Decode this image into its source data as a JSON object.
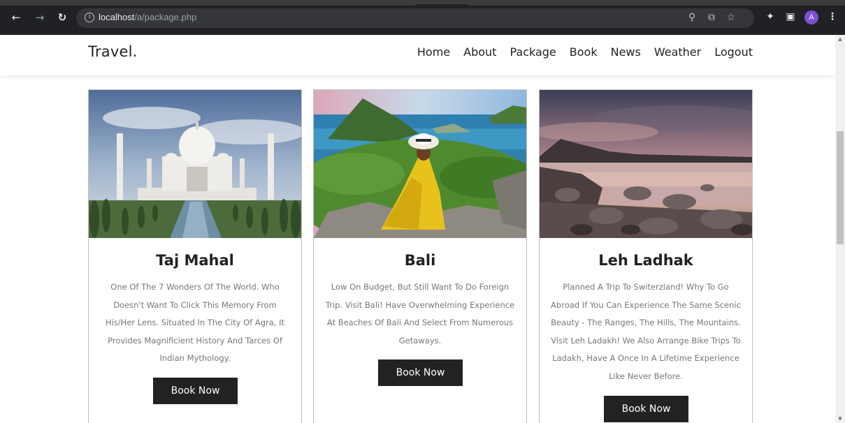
{
  "browser": {
    "back_icon": "arrow-left-icon",
    "forward_icon": "arrow-right-icon",
    "reload_icon": "reload-icon",
    "url_host": "localhost",
    "url_path": "/a/package.php",
    "profile_initial": "A"
  },
  "site": {
    "logo": "Travel.",
    "nav": [
      "Home",
      "About",
      "Package",
      "Book",
      "News",
      "Weather",
      "Logout"
    ]
  },
  "packages": [
    {
      "title": "Taj Mahal",
      "description": "One Of The 7 Wonders Of The World. Who Doesn't Want To Click This Memory From His/Her Lens. Situated In The City Of Agra, It Provides Magnificient History And Tarces Of Indian Mythology.",
      "button": "Book Now"
    },
    {
      "title": "Bali",
      "description": "Low On Budget, But Still Want To Do Foreign Trip. Visit Bali! Have Overwhelming Experience At Beaches Of Bali And Select From Numerous Getaways.",
      "button": "Book Now"
    },
    {
      "title": "Leh Ladhak",
      "description": "Planned A Trip To Switerzland! Why To Go Abroad If You Can Experience The Same Scenic Beauty - The Ranges, The Hills, The Mountains. Visit Leh Ladakh! We Also Arrange Bike Trips To Ladakh, Have A Once In A Lifetime Experience Like Never Before.",
      "button": "Book Now"
    }
  ]
}
